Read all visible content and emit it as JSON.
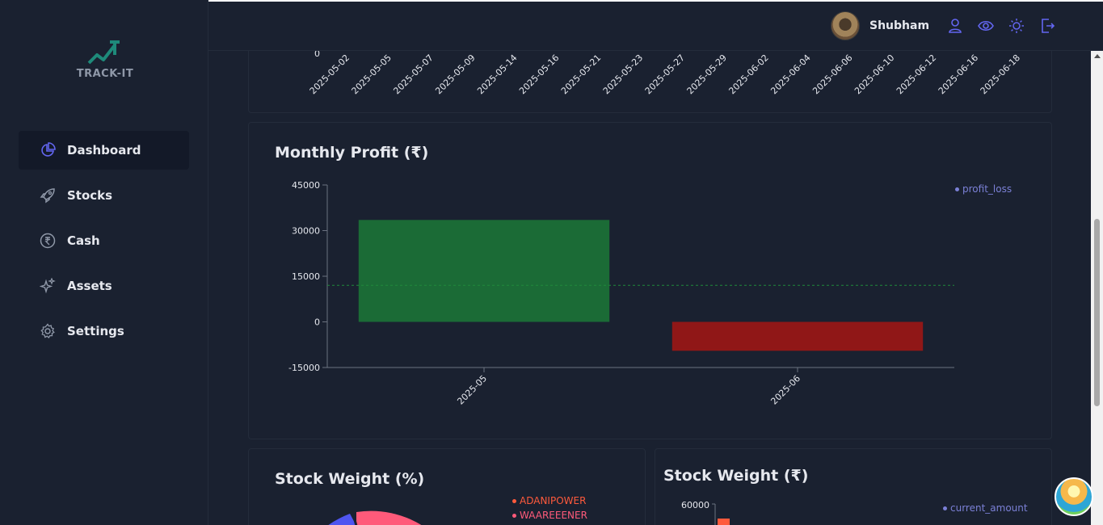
{
  "app": {
    "logo_text": "TRACK-IT"
  },
  "sidebar": {
    "items": [
      {
        "label": "Dashboard",
        "icon": "pie-chart-icon",
        "active": true
      },
      {
        "label": "Stocks",
        "icon": "rocket-icon",
        "active": false
      },
      {
        "label": "Cash",
        "icon": "rupee-circle-icon",
        "active": false
      },
      {
        "label": "Assets",
        "icon": "sparkles-icon",
        "active": false
      },
      {
        "label": "Settings",
        "icon": "gear-icon",
        "active": false
      }
    ]
  },
  "topbar": {
    "user_name": "Shubham",
    "icons": [
      "user-icon",
      "eye-icon",
      "sun-icon",
      "logout-icon"
    ],
    "accent": "#6366f1"
  },
  "top_chart": {
    "x_tick_labels": [
      "2025-05-02",
      "2025-05-05",
      "2025-05-07",
      "2025-05-09",
      "2025-05-14",
      "2025-05-16",
      "2025-05-21",
      "2025-05-23",
      "2025-05-27",
      "2025-05-29",
      "2025-06-02",
      "2025-06-04",
      "2025-06-06",
      "2025-06-10",
      "2025-06-12",
      "2025-06-16",
      "2025-06-18"
    ]
  },
  "profit_card": {
    "title": "Monthly Profit (₹)",
    "legend": "profit_loss"
  },
  "chart_data": {
    "type": "bar",
    "categories": [
      "2025-05",
      "2025-06"
    ],
    "values": [
      33500,
      -9500
    ],
    "colors": [
      "#1b6b36",
      "#901717"
    ],
    "yticks": [
      45000,
      30000,
      15000,
      0,
      -15000
    ],
    "ylim": [
      -15000,
      45000
    ],
    "reference_line": 12000,
    "legend": "profit_loss",
    "legend_position": "top-right",
    "grid": false
  },
  "weight_pct_card": {
    "title": "Stock Weight (%)",
    "legend": [
      {
        "label": "ADANIPOWER",
        "color": "#ff5a3c"
      },
      {
        "label": "WAAREEENER",
        "color": "#ff5a7a"
      }
    ]
  },
  "weight_amt_card": {
    "title": "Stock Weight (₹)",
    "legend": "current_amount",
    "ytick_top": "60000",
    "bar_color": "#ff5a3c"
  }
}
